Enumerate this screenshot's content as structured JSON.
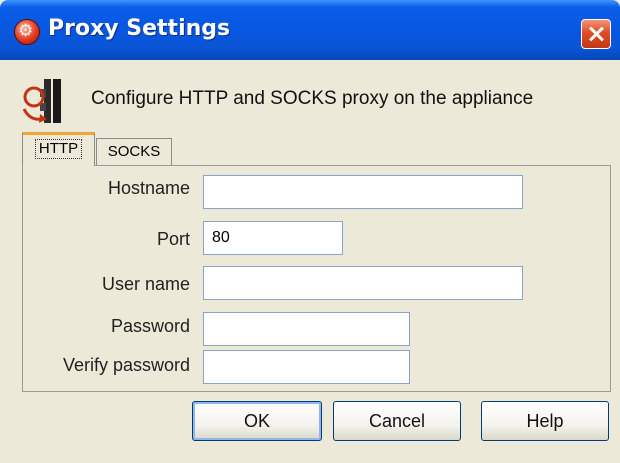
{
  "window": {
    "title": "Proxy Settings"
  },
  "header": {
    "description": "Configure HTTP and SOCKS proxy on the appliance"
  },
  "tabs": [
    {
      "label": "HTTP",
      "selected": true
    },
    {
      "label": "SOCKS",
      "selected": false
    }
  ],
  "form": {
    "hostname": {
      "label": "Hostname",
      "value": ""
    },
    "port": {
      "label": "Port",
      "value": "80"
    },
    "username": {
      "label": "User name",
      "value": ""
    },
    "password": {
      "label": "Password",
      "value": ""
    },
    "verify_password": {
      "label": "Verify password",
      "value": ""
    }
  },
  "buttons": {
    "ok": "OK",
    "cancel": "Cancel",
    "help": "Help"
  },
  "icons": {
    "app": "settings-gear-icon",
    "header": "proxy-connector-icon",
    "close": "close-icon"
  },
  "colors": {
    "titlebar": "#0858e3",
    "dialog_bg": "#ece9d8",
    "tab_accent": "#f2a535",
    "close_button": "#de4d26"
  }
}
